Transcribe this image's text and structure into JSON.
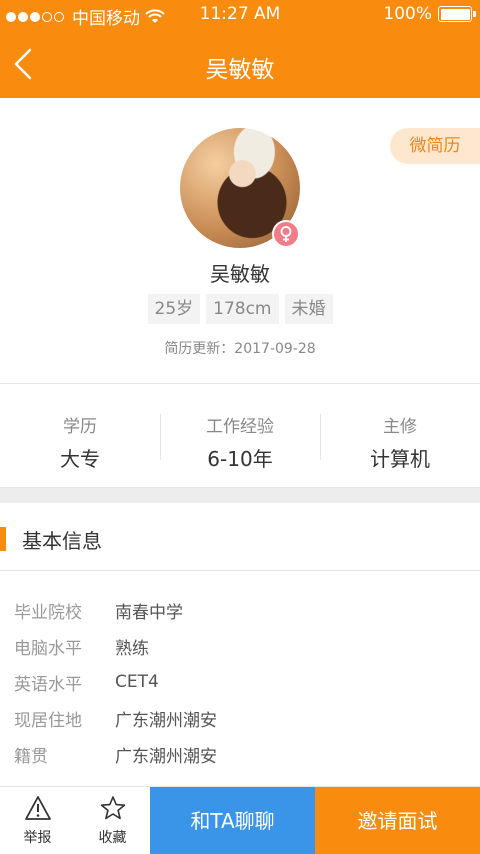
{
  "statusbar": {
    "carrier": "●●●○○ 中国移动",
    "carrier_text": "中国移动",
    "time": "11:27 AM",
    "battery": "100%"
  },
  "nav": {
    "title": "吴敏敏"
  },
  "profile": {
    "badge": "微简历",
    "name": "吴敏敏",
    "tags": [
      "25岁",
      "178cm",
      "未婚"
    ],
    "updated": "简历更新：2017-09-28"
  },
  "stats": [
    {
      "label": "学历",
      "value": "大专"
    },
    {
      "label": "工作经验",
      "value": "6-10年"
    },
    {
      "label": "主修",
      "value": "计算机"
    }
  ],
  "section": {
    "title": "基本信息"
  },
  "info": [
    {
      "label": "毕业院校",
      "value": "南春中学"
    },
    {
      "label": "电脑水平",
      "value": "熟练"
    },
    {
      "label": "英语水平",
      "value": "CET4"
    },
    {
      "label": "现居住地",
      "value": "广东潮州潮安"
    },
    {
      "label": "籍贯",
      "value": "广东潮州潮安"
    }
  ],
  "bottom": {
    "report": "举报",
    "favorite": "收藏",
    "chat": "和TA聊聊",
    "invite": "邀请面试"
  },
  "colors": {
    "accent": "#f98c0f",
    "chat": "#3a95e8",
    "female": "#f27d8a"
  }
}
